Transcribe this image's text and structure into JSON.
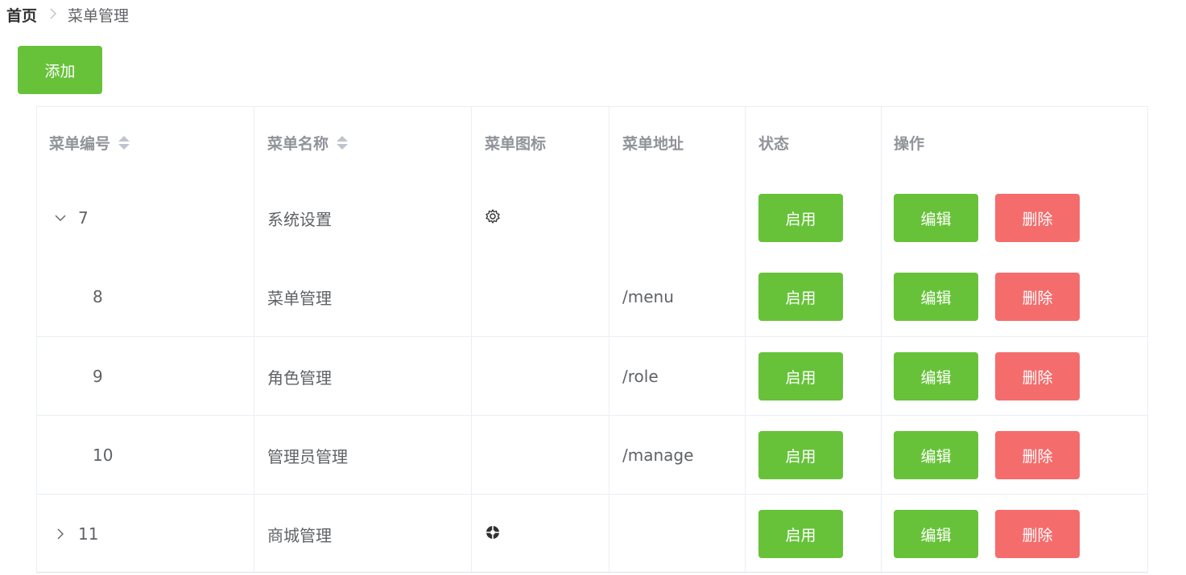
{
  "breadcrumb": {
    "home": "首页",
    "separator": ">",
    "current": "菜单管理"
  },
  "toolbar": {
    "add_label": "添加"
  },
  "table": {
    "columns": {
      "id": "菜单编号",
      "name": "菜单名称",
      "icon": "菜单图标",
      "path": "菜单地址",
      "status": "状态",
      "actions": "操作"
    },
    "rows": [
      {
        "id": "7",
        "name": "系统设置",
        "icon": "gear-icon",
        "path": "",
        "status": "启用",
        "edit": "编辑",
        "delete": "删除",
        "expanded": true
      },
      {
        "id": "8",
        "name": "菜单管理",
        "icon": "",
        "path": "/menu",
        "status": "启用",
        "edit": "编辑",
        "delete": "删除"
      },
      {
        "id": "9",
        "name": "角色管理",
        "icon": "",
        "path": "/role",
        "status": "启用",
        "edit": "编辑",
        "delete": "删除"
      },
      {
        "id": "10",
        "name": "管理员管理",
        "icon": "",
        "path": "/manage",
        "status": "启用",
        "edit": "编辑",
        "delete": "删除"
      },
      {
        "id": "11",
        "name": "商城管理",
        "icon": "aperture-icon",
        "path": "",
        "status": "启用",
        "edit": "编辑",
        "delete": "删除",
        "expanded": false
      }
    ]
  },
  "colors": {
    "primary_green": "#67c23a",
    "danger_red": "#f56c6c",
    "header_text": "#909399",
    "body_text": "#606266",
    "border": "#ebeef5"
  }
}
